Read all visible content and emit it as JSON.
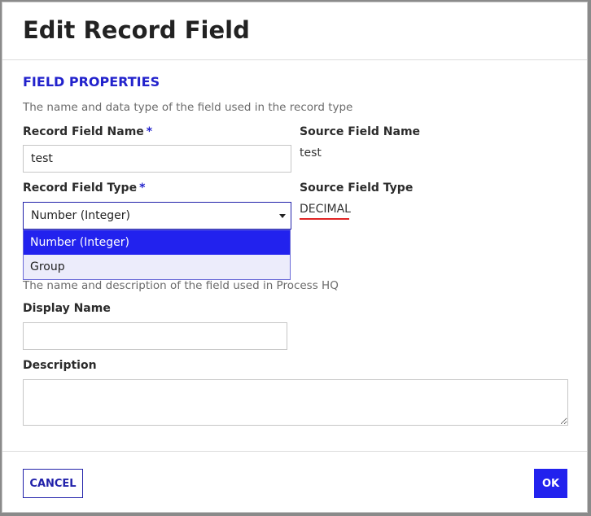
{
  "dialog": {
    "title": "Edit Record Field"
  },
  "field_properties": {
    "section_title": "FIELD PROPERTIES",
    "description": "The name and data type of the field used in the record type",
    "record_field_name_label": "Record Field Name",
    "record_field_name_value": "test",
    "required_marker": "*",
    "source_field_name_label": "Source Field Name",
    "source_field_name_value": "test",
    "record_field_type_label": "Record Field Type",
    "record_field_type_selected": "Number (Integer)",
    "record_field_type_options": [
      "Number (Integer)",
      "Group"
    ],
    "source_field_type_label": "Source Field Type",
    "source_field_type_value": "DECIMAL"
  },
  "display_properties": {
    "description": "The name and description of the field used in Process HQ",
    "display_name_label": "Display Name",
    "display_name_value": "",
    "description_label": "Description",
    "description_value": ""
  },
  "footer": {
    "cancel_label": "CANCEL",
    "ok_label": "OK"
  },
  "colors": {
    "accent": "#2222ee",
    "link_blue": "#2222cc",
    "error_underline": "#e02424"
  }
}
